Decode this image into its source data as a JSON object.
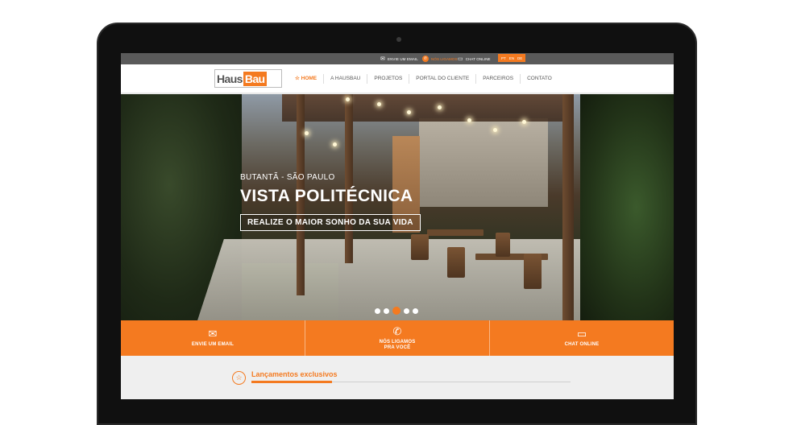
{
  "topbar": {
    "email": {
      "icon": "envelope-icon",
      "label": "ENVIE UM EMAIL"
    },
    "call": {
      "icon": "phone-icon",
      "label": "NÓS LIGAMOS"
    },
    "chat": {
      "icon": "chat-icon",
      "label": "CHAT ONLINE"
    },
    "languages": [
      "PT",
      "EN",
      "DE"
    ]
  },
  "brand": {
    "part1": "Haus",
    "part2": "Bau",
    "accent": "#f47a20"
  },
  "nav": {
    "items": [
      {
        "label": "HOME",
        "icon": "star-icon",
        "active": true
      },
      {
        "label": "A HAUSBAU"
      },
      {
        "label": "PROJETOS"
      },
      {
        "label": "PORTAL DO CLIENTE"
      },
      {
        "label": "PARCEIROS"
      },
      {
        "label": "CONTATO"
      }
    ]
  },
  "hero": {
    "location": "BUTANTÃ - SÃO PAULO",
    "title": "VISTA POLITÉCNICA",
    "cta": "REALIZE O MAIOR SONHO DA SUA VIDA",
    "slides": 5,
    "active_slide": 3
  },
  "actions": [
    {
      "icon": "envelope-icon",
      "label": "ENVIE UM EMAIL"
    },
    {
      "icon": "phone-icon",
      "label": "NÓS LIGAMOS\nPRA VOCÊ"
    },
    {
      "icon": "chat-icon",
      "label": "CHAT ONLINE"
    }
  ],
  "releases": {
    "icon": "star-icon",
    "title": "Lançamentos exclusivos"
  }
}
